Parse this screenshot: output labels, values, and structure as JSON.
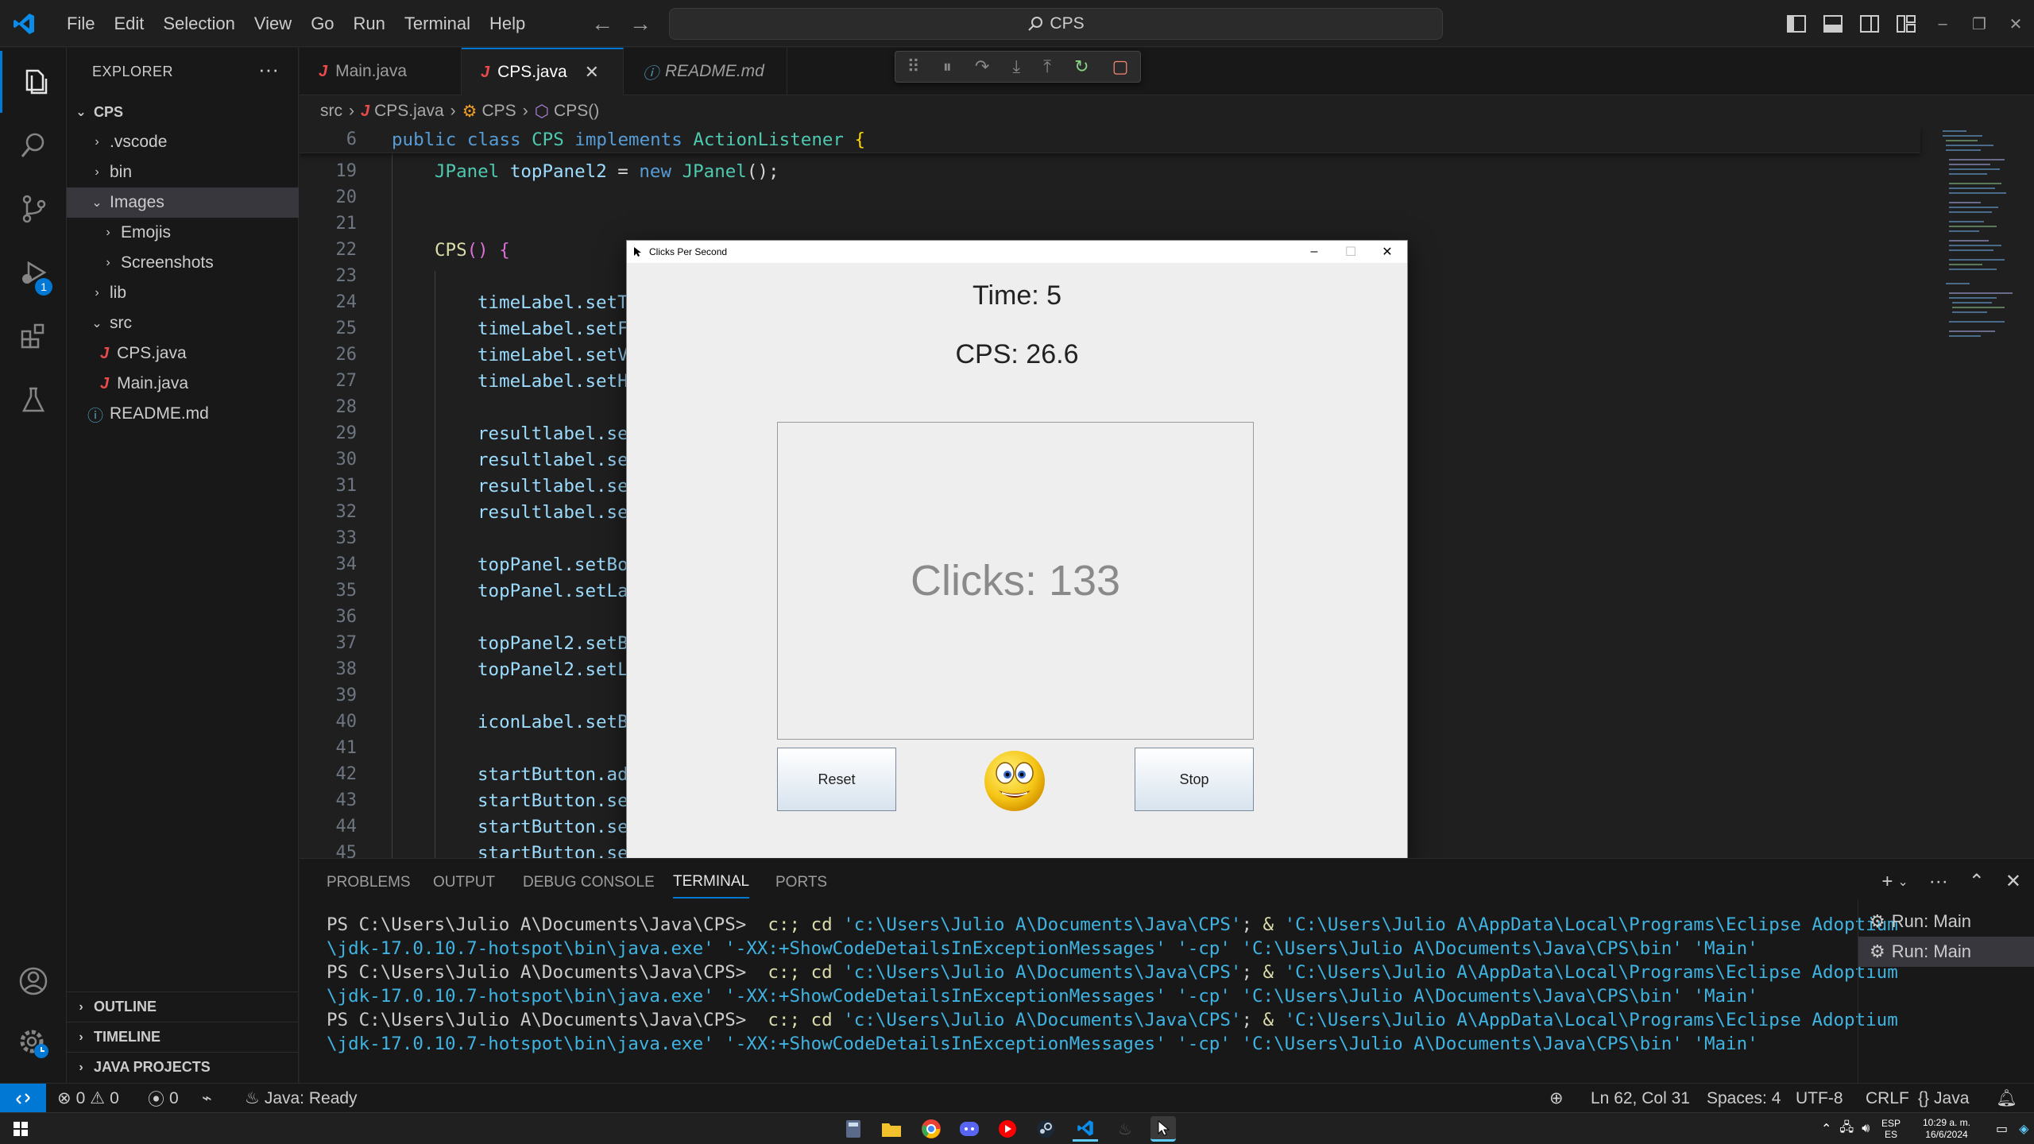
{
  "titlebar": {
    "menu": [
      "File",
      "Edit",
      "Selection",
      "View",
      "Go",
      "Run",
      "Terminal",
      "Help"
    ],
    "search": "CPS"
  },
  "sidebar": {
    "title": "EXPLORER",
    "root": "CPS",
    "items": [
      {
        "label": ".vscode"
      },
      {
        "label": "bin"
      },
      {
        "label": "Images"
      },
      {
        "label": "Emojis"
      },
      {
        "label": "Screenshots"
      },
      {
        "label": "lib"
      },
      {
        "label": "src"
      },
      {
        "label": "CPS.java"
      },
      {
        "label": "Main.java"
      },
      {
        "label": "README.md"
      }
    ],
    "sections": [
      "OUTLINE",
      "TIMELINE",
      "JAVA PROJECTS"
    ]
  },
  "tabs": [
    {
      "label": "Main.java"
    },
    {
      "label": "CPS.java"
    },
    {
      "label": "README.md"
    }
  ],
  "breadcrumb": [
    "src",
    "CPS.java",
    "CPS",
    "CPS()"
  ],
  "editor": {
    "line_numbers": [
      "6",
      "19",
      "20",
      "21",
      "22",
      "23",
      "24",
      "25",
      "26",
      "27",
      "28",
      "29",
      "30",
      "31",
      "32",
      "33",
      "34",
      "35",
      "36",
      "37",
      "38",
      "39",
      "40",
      "41",
      "42",
      "43",
      "44",
      "45"
    ],
    "sticky": {
      "public": "public",
      "class": "class",
      "name": "CPS",
      "implements": "implements",
      "iface": "ActionListener",
      "brace": "{"
    },
    "line19": {
      "type": "JPanel",
      "var": "topPanel2",
      "eq": " = ",
      "new": "new",
      "ctor": "JPanel",
      "end": "();"
    },
    "line22": {
      "ctor": "CPS",
      "paren": "()",
      "brace": "{"
    },
    "truncated_lines": [
      "timeLabel.setT",
      "timeLabel.setF",
      "timeLabel.setV",
      "timeLabel.setH",
      "resultlabel.se",
      "resultlabel.se",
      "resultlabel.se",
      "resultlabel.se",
      "topPanel.setBo",
      "topPanel.setLa",
      "topPanel2.setB",
      "topPanel2.setL",
      "iconLabel.setB",
      "startButton.ad",
      "startButton.se",
      "startButton.se",
      "startButton.se"
    ]
  },
  "app_window": {
    "title": "Clicks Per Second",
    "time_label": "Time: 5",
    "cps_label": "CPS: 26.6",
    "clicks_label": "Clicks: 133",
    "reset_button": "Reset",
    "stop_button": "Stop"
  },
  "panel": {
    "tabs": [
      "PROBLEMS",
      "OUTPUT",
      "DEBUG CONSOLE",
      "TERMINAL",
      "PORTS"
    ],
    "active_tab": "TERMINAL",
    "terminal": {
      "prompt": "PS C:\\Users\\Julio A\\Documents\\Java\\CPS>",
      "cmd": "c:; cd",
      "path": "'c:\\Users\\Julio A\\Documents\\Java\\CPS'",
      "sep": ";",
      "amp": "&",
      "java_path_1": "'C:\\Users\\Julio A\\AppData\\Local\\Programs\\Eclipse Adoptium",
      "java_path_2": "\\jdk-17.0.10.7-hotspot\\bin\\java.exe'",
      "flag": "'-XX:+ShowCodeDetailsInExceptionMessages'",
      "cp": "'-cp'",
      "bin": "'C:\\Users\\Julio A\\Documents\\Java\\CPS\\bin'",
      "main": "'Main'"
    },
    "terminal_list": [
      "Run: Main",
      "Run: Main"
    ]
  },
  "statusbar": {
    "errors": "0",
    "warnings": "0",
    "ports": "0",
    "java": "Java: Ready",
    "position": "Ln 62, Col 31",
    "spaces": "Spaces: 4",
    "encoding": "UTF-8",
    "eol": "CRLF",
    "language": "Java"
  },
  "taskbar": {
    "lang": "ESP",
    "lang2": "ES",
    "time": "10:29 a. m.",
    "date": "16/6/2024"
  },
  "colors": {
    "accent": "#0078d4",
    "java_icon": "#e84b4b"
  }
}
